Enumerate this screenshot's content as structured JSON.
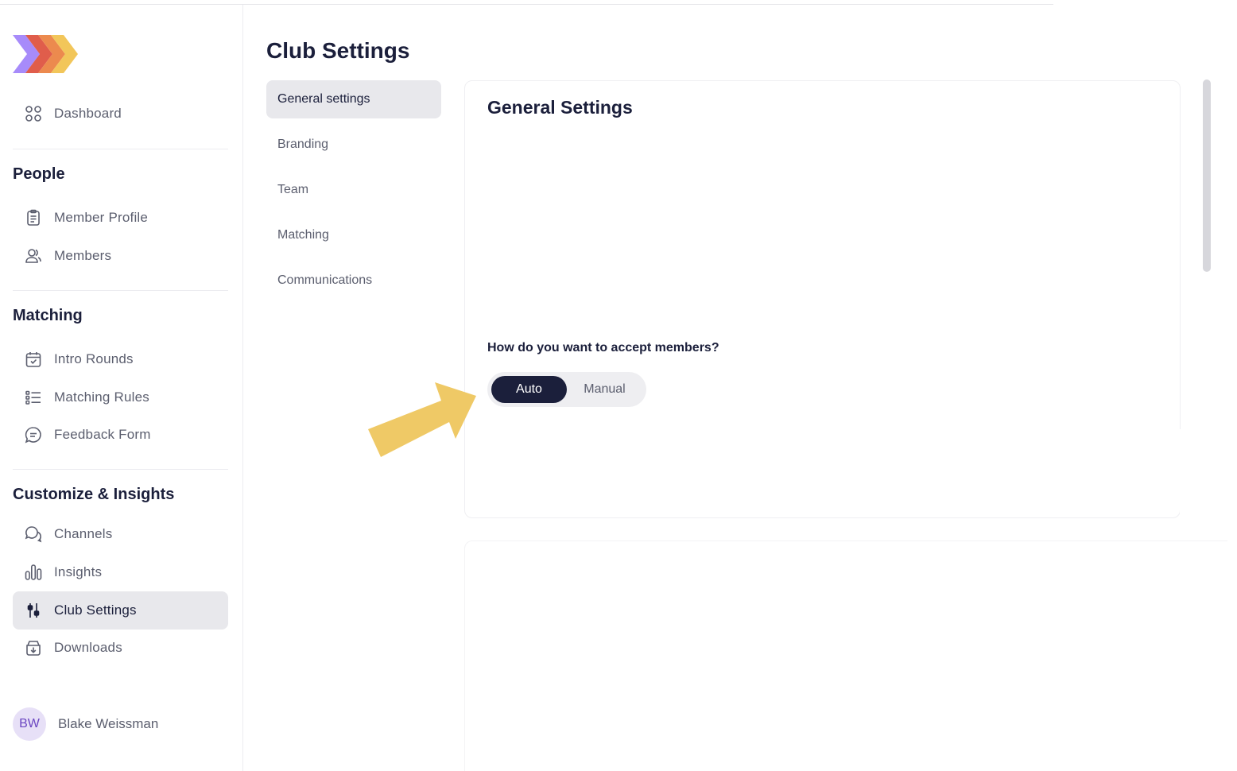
{
  "brand": {
    "logo_icon": "chevron-stack-logo",
    "colors": [
      "#a78bfa",
      "#e05d4b",
      "#ec8a4e",
      "#f2c65a"
    ]
  },
  "sidebar": {
    "dashboard": {
      "label": "Dashboard",
      "icon": "grid-icon"
    },
    "sections": [
      {
        "heading": "People",
        "items": [
          {
            "label": "Member Profile",
            "icon": "clipboard-icon"
          },
          {
            "label": "Members",
            "icon": "users-icon"
          }
        ]
      },
      {
        "heading": "Matching",
        "items": [
          {
            "label": "Intro Rounds",
            "icon": "calendar-check-icon"
          },
          {
            "label": "Matching Rules",
            "icon": "list-icon"
          },
          {
            "label": "Feedback Form",
            "icon": "message-icon"
          }
        ]
      },
      {
        "heading": "Customize & Insights",
        "items": [
          {
            "label": "Channels",
            "icon": "chat-bubbles-icon"
          },
          {
            "label": "Insights",
            "icon": "bar-chart-icon"
          },
          {
            "label": "Club Settings",
            "icon": "sliders-icon",
            "active": true
          },
          {
            "label": "Downloads",
            "icon": "download-box-icon"
          }
        ]
      }
    ],
    "user": {
      "initials": "BW",
      "name": "Blake Weissman"
    }
  },
  "main": {
    "title": "Club Settings",
    "sub_nav": [
      {
        "label": "General settings",
        "active": true
      },
      {
        "label": "Branding"
      },
      {
        "label": "Team"
      },
      {
        "label": "Matching"
      },
      {
        "label": "Communications"
      }
    ],
    "card": {
      "title": "General Settings",
      "question": "How do you want to accept members?",
      "toggle": {
        "options": [
          "Auto",
          "Manual"
        ],
        "selected": "Auto"
      }
    }
  },
  "annotation": {
    "arrow_color": "#efc966"
  }
}
